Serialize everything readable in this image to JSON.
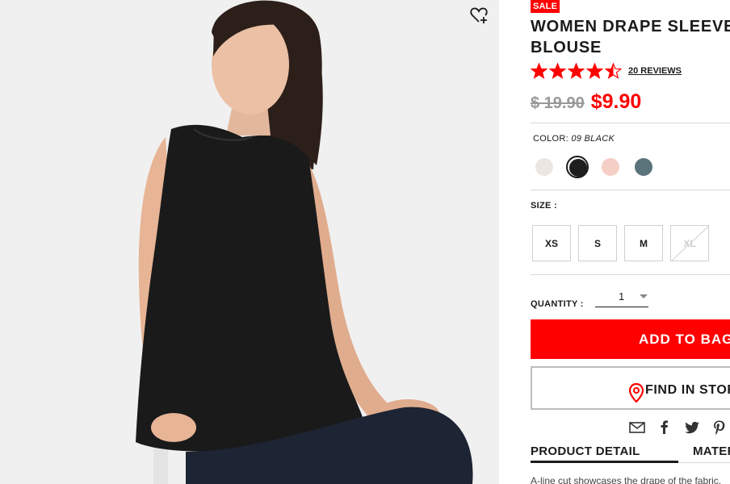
{
  "product": {
    "badge": "SALE",
    "title_line1": "WOMEN DRAPE SLEEVELESS",
    "title_line2": "BLOUSE",
    "rating": 4.5,
    "reviews_label": "20 REVIEWS",
    "old_price": "$ 19.90",
    "new_price": "$9.90"
  },
  "color": {
    "label": "COLOR:",
    "selected": "09 BLACK",
    "swatches": [
      {
        "name": "off-white",
        "hex": "#ebe6e1"
      },
      {
        "name": "black",
        "hex": "#1e1e1e",
        "selected": true
      },
      {
        "name": "pink",
        "hex": "#f4cfc5"
      },
      {
        "name": "slate",
        "hex": "#5b737a"
      }
    ]
  },
  "size": {
    "label": "SIZE :",
    "options": [
      {
        "label": "XS",
        "available": true
      },
      {
        "label": "S",
        "available": true
      },
      {
        "label": "M",
        "available": true
      },
      {
        "label": "XL",
        "available": false
      }
    ]
  },
  "quantity": {
    "label": "QUANTITY :",
    "value": "1"
  },
  "actions": {
    "add_to_bag": "ADD TO BAG",
    "find_in_store": "FIND IN STORE"
  },
  "share_icons": [
    "mail-icon",
    "facebook-icon",
    "twitter-icon",
    "pinterest-icon"
  ],
  "tabs": [
    "PRODUCT DETAIL",
    "MATERIALS"
  ],
  "description": "A-line cut showcases the drape of the fabric.",
  "colors": {
    "brand_red": "#ff0000",
    "text": "#1b1b1b",
    "muted": "#999999"
  }
}
